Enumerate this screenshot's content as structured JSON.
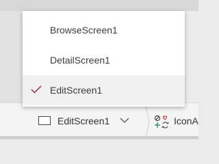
{
  "screen_dropdown": {
    "options": [
      {
        "label": "BrowseScreen1",
        "selected": false
      },
      {
        "label": "DetailScreen1",
        "selected": false
      },
      {
        "label": "EditScreen1",
        "selected": true
      }
    ]
  },
  "bottom_bar": {
    "current_screen": "EditScreen1",
    "insert_item_label": "IconA"
  },
  "colors": {
    "checkmark": "#a33d6b",
    "selected_bg": "#f0f0f0",
    "dropdown_bg": "#ffffff"
  },
  "icons": [
    "check-icon",
    "screen-icon",
    "chevron-down-icon",
    "icons-gallery-icon"
  ]
}
